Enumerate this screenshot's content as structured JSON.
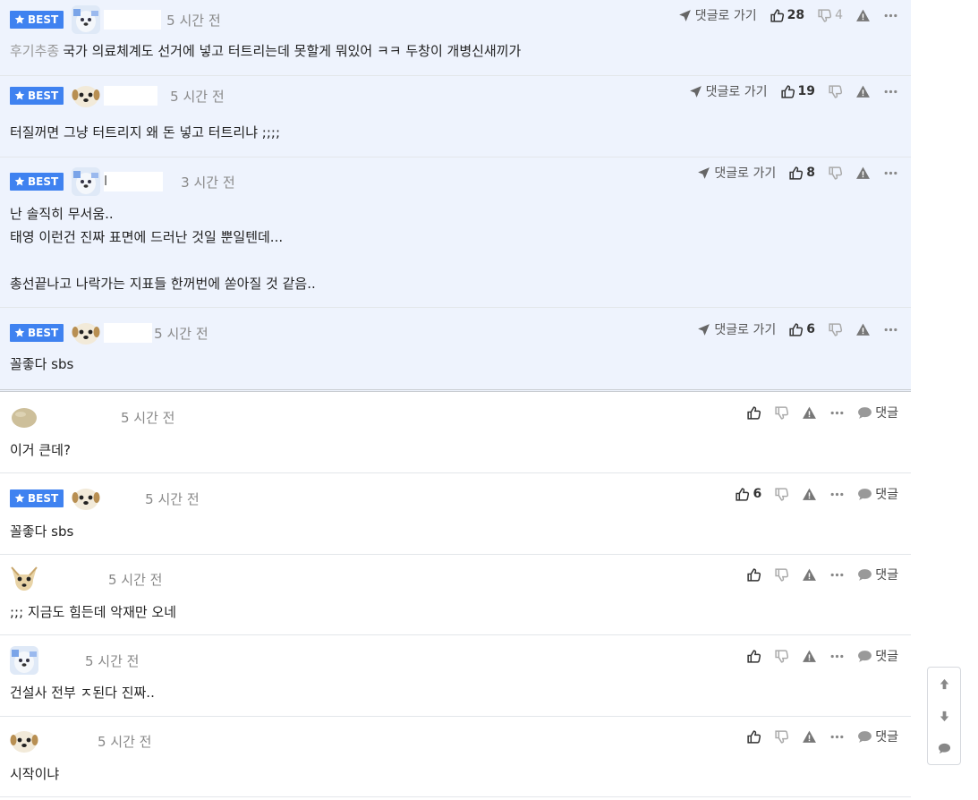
{
  "labels": {
    "best": "BEST",
    "goto_reply": "댓글로 가기",
    "reply": "댓글"
  },
  "colors": {
    "best_badge": "#3f82f0",
    "best_row_bg": "#eef3fd"
  },
  "best_comments": [
    {
      "time": "5 시간 전",
      "prefix": "후기추종",
      "text": "국가 의료체계도 선거에 넣고 터트리는데 못할게 뭐있어 ㅋㅋ 두창이 개병신새끼가",
      "likes": "28",
      "dislikes": "4",
      "avatar": "dog-white-icon"
    },
    {
      "time": "5 시간 전",
      "text": "터질꺼면 그냥 터트리지 왜 돈 넣고 터트리냐 ;;;;",
      "likes": "19",
      "dislikes": "",
      "avatar": "puppy-face-icon"
    },
    {
      "time": "3 시간 전",
      "nick": "l",
      "text": [
        "난 솔직히 무서움..",
        "태영 이런건 진짜 표면에 드러난 것일 뿐일텐데...",
        "",
        "총선끝나고 나락가는 지표들 한꺼번에 쏟아질 것 같음.."
      ],
      "likes": "8",
      "dislikes": "",
      "avatar": "dog-white-icon"
    },
    {
      "time": "5 시간 전",
      "text": "꼴좋다 sbs",
      "likes": "6",
      "dislikes": "",
      "avatar": "puppy-face-icon"
    }
  ],
  "comments": [
    {
      "time": "5 시간 전",
      "text": "이거 큰데?",
      "likes": "",
      "best": false,
      "avatar": "potato-icon"
    },
    {
      "time": "5 시간 전",
      "text": "꼴좋다 sbs",
      "likes": "6",
      "best": true,
      "avatar": "puppy-face-icon"
    },
    {
      "time": "5 시간 전",
      "text": ";;; 지금도 힘든데 악재만 오네",
      "likes": "",
      "best": false,
      "avatar": "chihuahua-icon"
    },
    {
      "time": "5 시간 전",
      "text": "건설사 전부 ㅈ된다 진짜..",
      "likes": "",
      "best": false,
      "avatar": "dog-white-icon"
    },
    {
      "time": "5 시간 전",
      "text": "시작이냐",
      "likes": "",
      "best": false,
      "avatar": "puppy-face-icon"
    }
  ]
}
